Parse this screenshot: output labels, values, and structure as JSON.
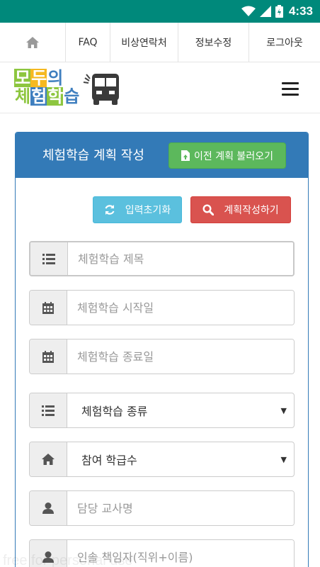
{
  "status_bar": {
    "time": "4:33"
  },
  "nav": {
    "items": [
      {
        "label": ""
      },
      {
        "label": "FAQ"
      },
      {
        "label": "비상연락처"
      },
      {
        "label": "정보수정"
      },
      {
        "label": "로그아웃"
      }
    ]
  },
  "logo": {
    "line1": [
      "모",
      "두",
      "의"
    ],
    "line2": [
      "체",
      "험",
      "학",
      "습"
    ],
    "colors": {
      "green": "#8dc63f",
      "blue": "#3f7fbf",
      "yellow": "#f5b921",
      "dark": "#333333"
    }
  },
  "panel": {
    "title": "체험학습 계획 작성",
    "load_button": "이전 계획 불러오기",
    "reset_button": "입력초기화",
    "write_button": "계획작성하기"
  },
  "form": {
    "title_placeholder": "체험학습 제목",
    "start_placeholder": "체험학습 시작일",
    "end_placeholder": "체험학습 종료일",
    "type_select": "체험학습 종류",
    "grade_select": "참여 학급수",
    "teacher_placeholder": "담당 교사명",
    "leader_placeholder": "인솔 책임자(직위+이름)"
  },
  "watermark": "free for personal use",
  "colors": {
    "statusbar": "#00897b",
    "primary": "#337ab7",
    "success": "#5cb85c",
    "info": "#5bc0de",
    "danger": "#d9534f"
  }
}
